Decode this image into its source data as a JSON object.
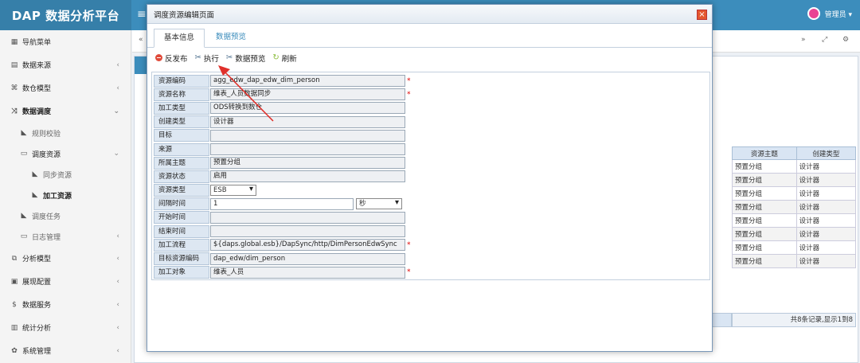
{
  "brand": "DAP 数据分析平台",
  "header": {
    "menu_icon": "hamburger-icon",
    "user_label": "管理员 ▾"
  },
  "sidebar": {
    "items": [
      {
        "label": "导航菜单",
        "icon": "grid-icon"
      },
      {
        "label": "数据来源",
        "icon": "database-icon"
      },
      {
        "label": "数仓模型",
        "icon": "share-icon"
      },
      {
        "label": "数据调度",
        "icon": "shuffle-icon"
      },
      {
        "label": "规则校验",
        "icon": "tag-icon"
      },
      {
        "label": "调度资源",
        "icon": "folder-icon"
      },
      {
        "label": "同步资源",
        "icon": "tag-icon"
      },
      {
        "label": "加工资源",
        "icon": "tag-icon"
      },
      {
        "label": "调度任务",
        "icon": "tag-icon"
      },
      {
        "label": "日志管理",
        "icon": "folder-icon"
      },
      {
        "label": "分析模型",
        "icon": "model-icon"
      },
      {
        "label": "展现配置",
        "icon": "film-icon"
      },
      {
        "label": "数据服务",
        "icon": "dollar-icon"
      },
      {
        "label": "统计分析",
        "icon": "bar-chart-icon"
      },
      {
        "label": "系统管理",
        "icon": "gear-icon"
      }
    ]
  },
  "background": {
    "table": {
      "headers": [
        "资源主题",
        "创建类型"
      ],
      "rows": [
        [
          "预置分组",
          "设计器"
        ],
        [
          "预置分组",
          "设计器"
        ],
        [
          "预置分组",
          "设计器"
        ],
        [
          "预置分组",
          "设计器"
        ],
        [
          "预置分组",
          "设计器"
        ],
        [
          "预置分组",
          "设计器"
        ],
        [
          "预置分组",
          "设计器"
        ],
        [
          "预置分组",
          "设计器"
        ]
      ]
    },
    "footer": "共8条记录,显示1到8"
  },
  "dialog": {
    "title": "调度资源编辑页面",
    "tabs": [
      "基本信息",
      "数据预览"
    ],
    "toolbar": {
      "unpublish": "反发布",
      "execute": "执行",
      "preview": "数据预览",
      "refresh": "刷新"
    },
    "form": [
      {
        "label": "资源编码",
        "value": "agg_edw_dap_edw_dim_person",
        "required": true
      },
      {
        "label": "资源名称",
        "value": "维表_人员数据同步",
        "required": true
      },
      {
        "label": "加工类型",
        "value": "ODS转换到数仓",
        "required": false
      },
      {
        "label": "创建类型",
        "value": "设计器",
        "required": false
      },
      {
        "label": "目标",
        "value": "",
        "required": false
      },
      {
        "label": "来源",
        "value": "",
        "required": false
      },
      {
        "label": "所属主题",
        "value": "预置分组",
        "required": false
      },
      {
        "label": "资源状态",
        "value": "启用",
        "required": false
      },
      {
        "label": "资源类型",
        "value": "ESB",
        "required": false,
        "select": true
      },
      {
        "label": "间隔时间",
        "value": "1",
        "required": false,
        "unit": "秒"
      },
      {
        "label": "开始时间",
        "value": "",
        "required": false
      },
      {
        "label": "结束时间",
        "value": "",
        "required": false
      },
      {
        "label": "加工流程",
        "value": "${daps.global.esb}/DapSync/http/DimPersonEdwSync",
        "required": true
      },
      {
        "label": "目标资源编码",
        "value": "dap_edw/dim_person",
        "required": false
      },
      {
        "label": "加工对象",
        "value": "维表_人员",
        "required": true
      }
    ]
  }
}
